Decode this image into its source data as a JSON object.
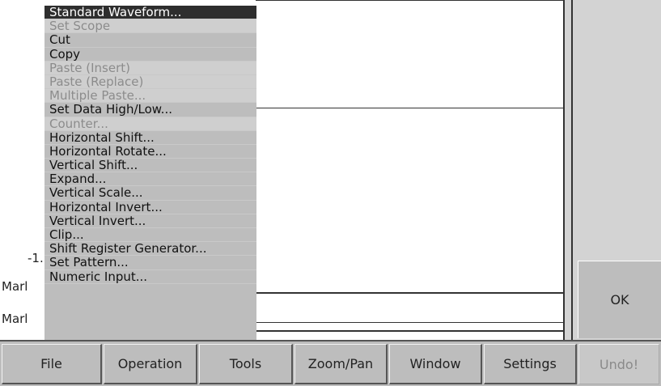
{
  "context_menu": {
    "items": [
      {
        "label": "Standard Waveform...",
        "state": "selected"
      },
      {
        "label": "Set Scope",
        "state": "disabled"
      },
      {
        "label": "Cut",
        "state": "enabled"
      },
      {
        "label": "Copy",
        "state": "enabled"
      },
      {
        "label": "Paste (Insert)",
        "state": "disabled"
      },
      {
        "label": "Paste (Replace)",
        "state": "disabled"
      },
      {
        "label": "Multiple Paste...",
        "state": "disabled"
      },
      {
        "label": "Set Data High/Low...",
        "state": "enabled"
      },
      {
        "label": "Counter...",
        "state": "disabled"
      },
      {
        "label": "Horizontal Shift...",
        "state": "enabled"
      },
      {
        "label": "Horizontal Rotate...",
        "state": "enabled"
      },
      {
        "label": "Vertical Shift...",
        "state": "enabled"
      },
      {
        "label": "Expand...",
        "state": "enabled"
      },
      {
        "label": "Vertical Scale...",
        "state": "enabled"
      },
      {
        "label": "Horizontal Invert...",
        "state": "enabled"
      },
      {
        "label": "Vertical Invert...",
        "state": "enabled"
      },
      {
        "label": "Clip...",
        "state": "enabled"
      },
      {
        "label": "Shift Register Generator...",
        "state": "enabled"
      },
      {
        "label": "Set Pattern...",
        "state": "enabled"
      },
      {
        "label": "Numeric Input...",
        "state": "enabled"
      }
    ]
  },
  "left_labels": {
    "value": "-1.",
    "marker1": "Marl",
    "marker2": "Marl"
  },
  "dialog": {
    "ok_label": "OK"
  },
  "bottom_menu": {
    "items": [
      {
        "label": "File",
        "enabled": true
      },
      {
        "label": "Operation",
        "enabled": true
      },
      {
        "label": "Tools",
        "enabled": true
      },
      {
        "label": "Zoom/Pan",
        "enabled": true
      },
      {
        "label": "Window",
        "enabled": true
      },
      {
        "label": "Settings",
        "enabled": true
      },
      {
        "label": "Undo!",
        "enabled": false
      }
    ]
  },
  "colors": {
    "menu_bg": "#bdbdbd",
    "selected_bg": "#2e2e2e",
    "disabled_text": "#8c8c8c"
  }
}
